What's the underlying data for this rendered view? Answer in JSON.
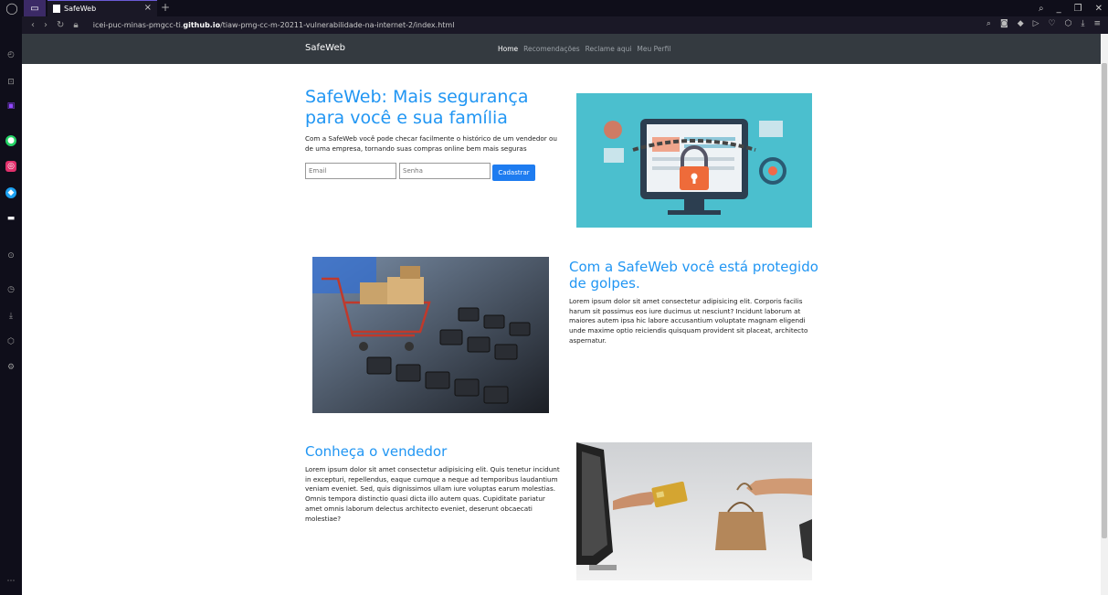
{
  "browser": {
    "tab_title": "SafeWeb",
    "url_prefix": "icei-puc-minas-pmgcc-ti.",
    "url_bold": "github.io",
    "url_suffix": "/tiaw-pmg-cc-m-20211-vulnerabilidade-na-internet-2/index.html"
  },
  "navbar": {
    "brand": "SafeWeb",
    "links": [
      "Home",
      "Recomendações",
      "Reclame aqui",
      "Meu Perfil"
    ]
  },
  "hero": {
    "title": "SafeWeb: Mais segurança para você e sua família",
    "text": "Com a SafeWeb você pode checar facilmente o histórico de um vendedor ou de uma empresa, tornando suas compras online bem mais seguras",
    "email_placeholder": "Email",
    "password_placeholder": "Senha",
    "button": "Cadastrar"
  },
  "section2": {
    "title": "Com a SafeWeb você está protegido de golpes.",
    "text": "Lorem ipsum dolor sit amet consectetur adipisicing elit. Corporis facilis harum sit possimus eos iure ducimus ut nesciunt? Incidunt laborum at maiores autem ipsa hic labore accusantium voluptate magnam eligendi unde maxime optio reiciendis quisquam provident sit placeat, architecto aspernatur."
  },
  "section3": {
    "title": "Conheça o vendedor",
    "text": "Lorem ipsum dolor sit amet consectetur adipisicing elit. Quis tenetur incidunt in excepturi, repellendus, eaque cumque a neque ad temporibus laudantium veniam eveniet. Sed, quis dignissimos ullam iure voluptas earum molestias. Omnis tempora distinctio quasi dicta illo autem quas. Cupiditate pariatur amet omnis laborum delectus architecto eveniet, deserunt obcaecati molestiae?"
  },
  "colors": {
    "accent": "#2196f3",
    "navbar_bg": "#343a40",
    "button": "#1e7cf0"
  }
}
